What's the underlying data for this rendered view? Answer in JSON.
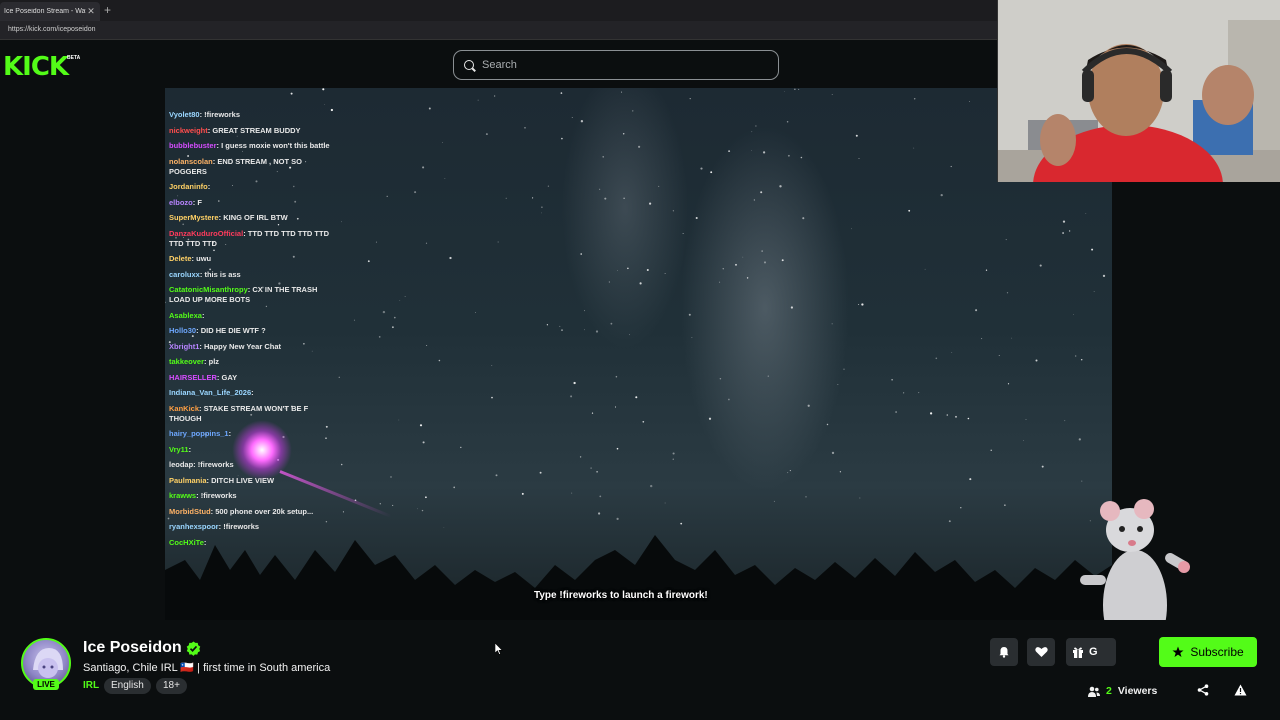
{
  "browser": {
    "tab_title": "Ice Poseidon Stream - Watch",
    "tab_close": "✕",
    "new_tab": "+",
    "url": "https://kick.com/iceposeidon"
  },
  "header": {
    "logo": "KICK",
    "logo_badge": "BETA",
    "search_placeholder": "Search"
  },
  "chat": [
    {
      "user": "Vyolet80",
      "color": "#9ad6ff",
      "text": "!fireworks"
    },
    {
      "user": "nickweight",
      "color": "#ff4d4d",
      "text": "GREAT STREAM BUDDY"
    },
    {
      "user": "bubblebuster",
      "color": "#d64dff",
      "text": "I guess moxie won't this battle"
    },
    {
      "user": "nolanscolan",
      "color": "#ffb366",
      "text": "END STREAM , NOT SO POGGERS"
    },
    {
      "user": "Jordaninfo",
      "color": "#ffd166",
      "text": ""
    },
    {
      "user": "elbozo",
      "color": "#b784ff",
      "text": "F"
    },
    {
      "user": "SuperMystere",
      "color": "#ffd166",
      "text": "KING OF IRL BTW"
    },
    {
      "user": "DanzaKuduroOfficial",
      "color": "#ff3b5c",
      "text": "TTD TTD TTD TTD TTD TTD TTD TTD"
    },
    {
      "user": "Delete",
      "color": "#ffd166",
      "text": "uwu"
    },
    {
      "user": "caroluxx",
      "color": "#9ad6ff",
      "text": "this is ass"
    },
    {
      "user": "CatatonicMisanthropy",
      "color": "#53fc18",
      "text": "CX IN THE TRASH  LOAD UP MORE BOTS"
    },
    {
      "user": "Asablexa",
      "color": "#53fc18",
      "text": ""
    },
    {
      "user": "Hollo30",
      "color": "#6ea8ff",
      "text": "DID HE DIE WTF ?"
    },
    {
      "user": "Xbright1",
      "color": "#b784ff",
      "text": "Happy New Year Chat"
    },
    {
      "user": "takkeover",
      "color": "#53fc18",
      "text": "plz"
    },
    {
      "user": "HAIRSELLER",
      "color": "#d64dff",
      "text": "GAY"
    },
    {
      "user": "Indiana_Van_Life_2026",
      "color": "#9ad6ff",
      "text": ""
    },
    {
      "user": "KanKick",
      "color": "#ff9f43",
      "text": "STAKE STREAM WON'T BE F THOUGH"
    },
    {
      "user": "hairy_poppins_1",
      "color": "#6ea8ff",
      "text": ""
    },
    {
      "user": "Vry11",
      "color": "#53fc18",
      "text": ""
    },
    {
      "user": "leodap",
      "color": "#e9e9e9",
      "text": "!fireworks"
    },
    {
      "user": "Paulmania",
      "color": "#ffd166",
      "text": "DITCH LIVE VIEW"
    },
    {
      "user": "krawws",
      "color": "#53fc18",
      "text": "!fireworks"
    },
    {
      "user": "MorbidStud",
      "color": "#ffb366",
      "text": "500 phone over 20k setup..."
    },
    {
      "user": "ryanhexspoor",
      "color": "#9ad6ff",
      "text": "!fireworks"
    },
    {
      "user": "CocHXiTe",
      "color": "#53fc18",
      "text": ""
    }
  ],
  "overlay": {
    "fireworks_hint": "Type !fireworks to launch a firework!"
  },
  "channel": {
    "name": "Ice Poseidon",
    "live_label": "LIVE",
    "title": "Santiago, Chile IRL 🇨🇱 | first time in South america",
    "category": "IRL",
    "tags": [
      "English",
      "18+"
    ],
    "gift_label": "G",
    "subscribe_label": "Subscribe",
    "viewer_count": "2",
    "viewers_label": "Viewers"
  },
  "colors": {
    "brand": "#53fc18",
    "background": "#0b0e0f",
    "button_bg": "#2a2e31"
  },
  "icons": [
    "search-icon",
    "verified-icon",
    "bell-icon",
    "heart-icon",
    "gift-icon",
    "star-icon",
    "viewers-icon",
    "share-icon",
    "report-icon"
  ]
}
